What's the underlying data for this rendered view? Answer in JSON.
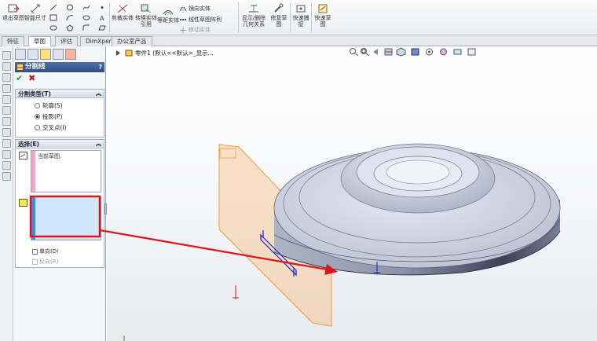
{
  "ribbon": {
    "btn_exit_sketch": "退出草图",
    "btn_smart_dim": "智能尺寸",
    "btn_trim": "剪裁实体",
    "btn_convert": "转换实体引用",
    "btn_offset": "等距实体",
    "small_mirror": "镜向实体",
    "small_linear_pattern": "线性草图阵列",
    "small_move": "移动实体",
    "btn_display_relations": "显示/删除几何关系",
    "btn_repair": "修复草图",
    "btn_quick_snap": "快速捕捉",
    "btn_rapid_sketch": "快速草图"
  },
  "tabs": [
    "特征",
    "草图",
    "评估",
    "DimXpert",
    "办公室产品"
  ],
  "active_tab": "草图",
  "property_manager": {
    "title": "分割线",
    "help": "?",
    "group_type": {
      "title": "分割类型(T)",
      "options": [
        "轮廓(S)",
        "投影(P)",
        "交叉点(I)"
      ],
      "selected": "投影(P)"
    },
    "group_selection": {
      "title": "选择(E)",
      "current_sketch": "当前草图.",
      "single_direction": "单向(D)",
      "reverse": "反向(R)"
    }
  },
  "viewport": {
    "tree_label": "零件1 (默认<<默认>_显示..."
  },
  "colors": {
    "pm_header": "#3a5c94",
    "highlight_red": "#e0141b",
    "plane_orange": "#f39a3a",
    "sketch_blue": "#1e22c8",
    "selection_blue": "#cfe6fb"
  }
}
